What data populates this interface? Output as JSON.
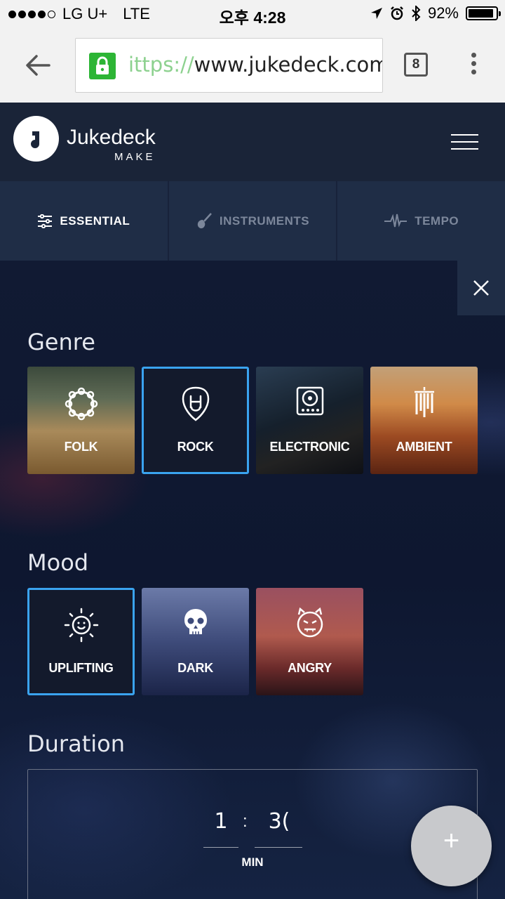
{
  "status_bar": {
    "carrier": "LG U+",
    "network": "LTE",
    "time": "오후 4:28",
    "battery": "92%",
    "battery_level": 0.92
  },
  "browser": {
    "url_faded": "ittps://",
    "url_main": "www.jukedeck.com",
    "tab_count": "8"
  },
  "app": {
    "brand": "Jukedeck",
    "brand_sub": "MAKE"
  },
  "tabs": [
    {
      "label": "ESSENTIAL",
      "icon": "sliders-icon",
      "active": true
    },
    {
      "label": "INSTRUMENTS",
      "icon": "guitar-icon",
      "active": false
    },
    {
      "label": "TEMPO",
      "icon": "pulse-icon",
      "active": false
    }
  ],
  "genre": {
    "title": "Genre",
    "items": [
      {
        "label": "FOLK",
        "icon": "tambourine-icon",
        "selected": false
      },
      {
        "label": "ROCK",
        "icon": "rock-hand-icon",
        "selected": true
      },
      {
        "label": "ELECTRONIC",
        "icon": "turntable-icon",
        "selected": false
      },
      {
        "label": "AMBIENT",
        "icon": "wind-chimes-icon",
        "selected": false
      }
    ]
  },
  "mood": {
    "title": "Mood",
    "items": [
      {
        "label": "UPLIFTING",
        "icon": "sun-icon",
        "selected": true
      },
      {
        "label": "DARK",
        "icon": "skull-icon",
        "selected": false
      },
      {
        "label": "ANGRY",
        "icon": "devil-icon",
        "selected": false
      }
    ]
  },
  "duration": {
    "title": "Duration",
    "minutes": "1",
    "colon": ":",
    "seconds": "3(",
    "unit_label": "MIN"
  },
  "fab": {
    "label": "+"
  },
  "colors": {
    "accent": "#3aa3ef",
    "header": "#1a2438",
    "tab_bar": "#1f2d46",
    "lock_green": "#2db535"
  }
}
